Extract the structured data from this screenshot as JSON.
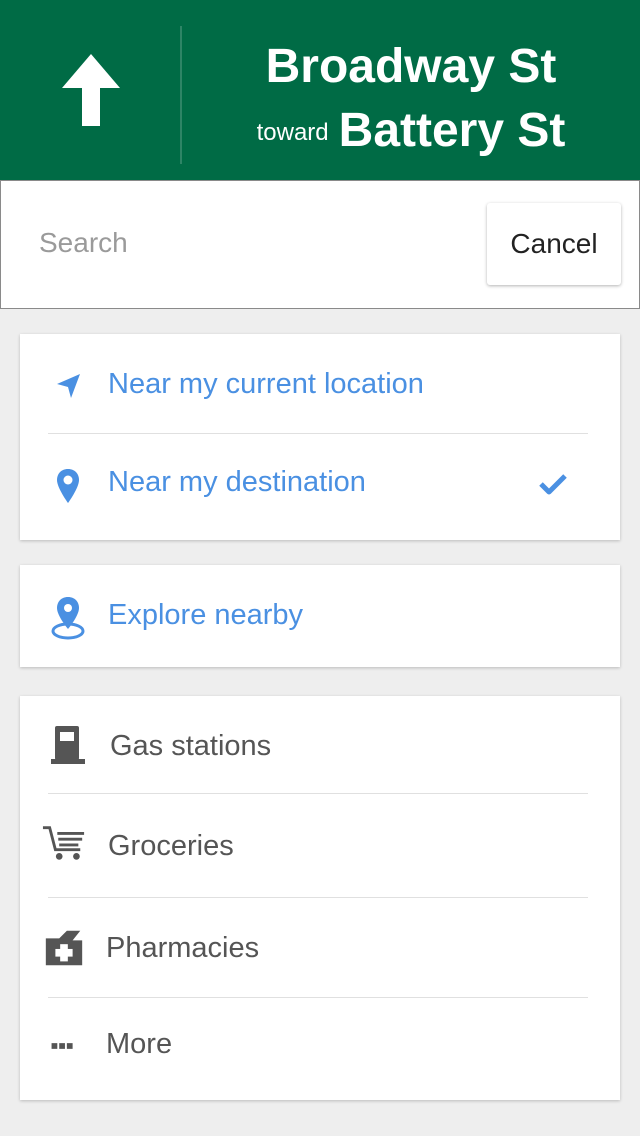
{
  "nav": {
    "street": "Broadway St",
    "toward_word": "toward",
    "toward_street": "Battery St",
    "direction_icon": "arrow-up-icon",
    "background_color": "#006b45"
  },
  "search": {
    "placeholder": "Search",
    "value": "",
    "cancel_label": "Cancel"
  },
  "search_along": {
    "items": [
      {
        "label": "Near my current location",
        "icon": "navigation-arrow-icon",
        "selected": false
      },
      {
        "label": "Near my destination",
        "icon": "location-pin-icon",
        "selected": true
      }
    ]
  },
  "explore": {
    "label": "Explore nearby",
    "icon": "explore-pin-icon"
  },
  "categories": {
    "items": [
      {
        "label": "Gas stations",
        "icon": "gas-station-icon"
      },
      {
        "label": "Groceries",
        "icon": "shopping-cart-icon"
      },
      {
        "label": "Pharmacies",
        "icon": "pharmacy-icon"
      },
      {
        "label": "More",
        "icon": "more-dots-icon"
      }
    ]
  },
  "colors": {
    "accent_blue": "#4a90e2",
    "header_green": "#006b45",
    "category_gray": "#555555"
  }
}
